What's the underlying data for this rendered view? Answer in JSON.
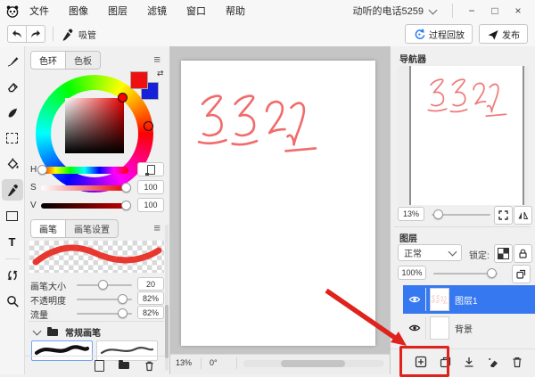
{
  "window": {
    "title": "动听的电话5259",
    "menus": [
      "文件",
      "图像",
      "图层",
      "滤镜",
      "窗口",
      "帮助"
    ],
    "controls": {
      "minimize": "−",
      "maximize": "□",
      "close": "×"
    }
  },
  "toolbar": {
    "eyedropper_label": "吸管",
    "replay_label": "过程回放",
    "publish_label": "发布"
  },
  "tools": [
    "brush",
    "eraser",
    "smudge",
    "select",
    "fill",
    "eyedropper",
    "shape",
    "text",
    "rotate",
    "zoom"
  ],
  "color_panel": {
    "tab_wheel": "色环",
    "tab_swatches": "色板",
    "h_label": "H",
    "s_label": "S",
    "v_label": "V",
    "s_value": "100",
    "v_value": "100"
  },
  "brush_panel": {
    "tab_brush": "画笔",
    "tab_settings": "画笔设置",
    "size_label": "画笔大小",
    "size_value": "20",
    "opacity_label": "不透明度",
    "opacity_value": "82%",
    "flow_label": "流量",
    "flow_value": "82%",
    "folder_label": "常规画笔"
  },
  "canvas": {
    "drawing_text": "3322",
    "zoom": "13%",
    "rotation": "0°"
  },
  "navigator": {
    "title": "导航器",
    "zoom": "13%",
    "preview_text": "3322"
  },
  "layers": {
    "title": "图层",
    "blend_mode": "正常",
    "lock_label": "锁定:",
    "opacity": "100%",
    "items": [
      {
        "name": "图层1",
        "selected": true,
        "thumb_text": "3322"
      },
      {
        "name": "背景",
        "selected": false,
        "thumb_text": ""
      }
    ]
  },
  "icons": {
    "menu": "≡",
    "swap": "⇄",
    "text_tool": "T"
  },
  "colors": {
    "selection_blue": "#3578f0",
    "annotation_red": "#e0221c",
    "canvas_stroke_red": "#f26b6b",
    "foreground_swatch": "#ee1010",
    "background_swatch": "#1520d8",
    "replay_icon_blue": "#2f7cf6"
  }
}
